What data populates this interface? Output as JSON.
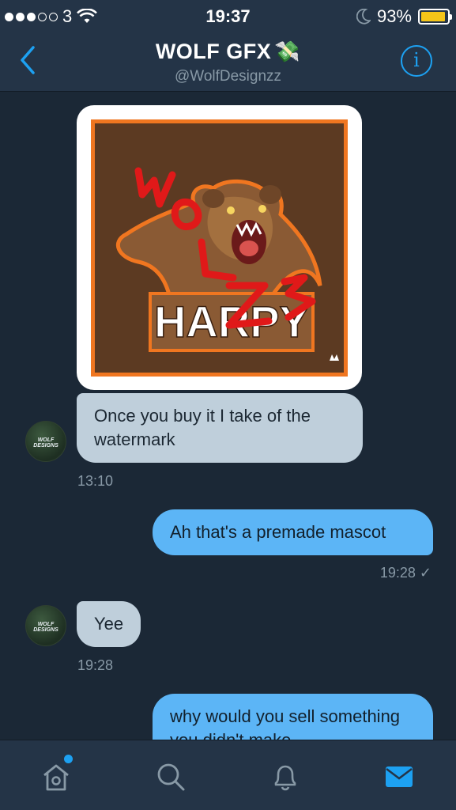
{
  "status_bar": {
    "carrier": "3",
    "time": "19:37",
    "battery": "93%",
    "battery_level": 0.93
  },
  "header": {
    "title": "WOLF GFX",
    "title_emoji": "💸",
    "handle": "@WolfDesignzz"
  },
  "messages": {
    "image": {
      "logo_text": "HARPY",
      "watermark_text": "WOLF"
    },
    "m1": {
      "text": "Once you buy it I take of the watermark",
      "time": "13:10"
    },
    "m2": {
      "text": "Ah that's a premade mascot",
      "time": "19:28 ✓"
    },
    "m3": {
      "text": "Yee",
      "time": "19:28"
    },
    "m4": {
      "text": "why would you sell something you didn't make"
    },
    "avatar_label": "WOLF DESIGNS"
  },
  "icons": {
    "back": "chevron-left-icon",
    "info": "info-icon",
    "home": "home-icon",
    "search": "search-icon",
    "notifications": "bell-icon",
    "messages": "envelope-icon"
  },
  "colors": {
    "background": "#1b2836",
    "bar": "#243447",
    "accent": "#1da1f2",
    "incoming_bubble": "#bfcfdb",
    "outgoing_bubble": "#5cb5f6"
  }
}
